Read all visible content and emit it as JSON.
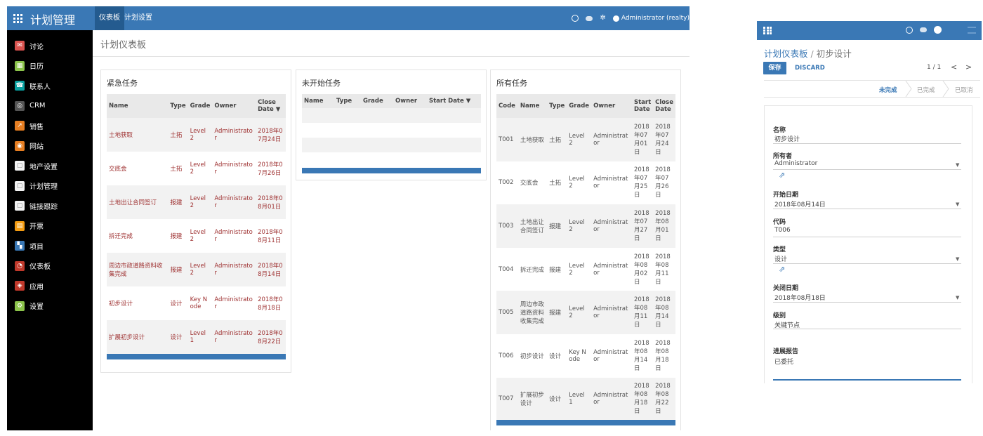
{
  "app": {
    "title": "计划管理",
    "nav": [
      "仪表板",
      "计划设置"
    ],
    "user": "Administrator (realty)"
  },
  "sidebar": {
    "items": [
      {
        "label": "讨论",
        "icon": "discuss-icon",
        "color": "#d9534f"
      },
      {
        "label": "日历",
        "icon": "calendar-icon",
        "color": "#8bc34a"
      },
      {
        "label": "联系人",
        "icon": "contacts-icon",
        "color": "#0aa0a0"
      },
      {
        "label": "CRM",
        "icon": "crm-icon",
        "color": "#555555"
      },
      {
        "label": "销售",
        "icon": "sales-icon",
        "color": "#e67e22"
      },
      {
        "label": "网站",
        "icon": "website-icon",
        "color": "#e67e22"
      },
      {
        "label": "地产设置",
        "icon": "module-icon",
        "color": "#f2f2f2"
      },
      {
        "label": "计划管理",
        "icon": "module-icon",
        "color": "#f2f2f2"
      },
      {
        "label": "链接跟踪",
        "icon": "module-icon",
        "color": "#f2f2f2"
      },
      {
        "label": "开票",
        "icon": "invoice-icon",
        "color": "#f39c12"
      },
      {
        "label": "项目",
        "icon": "project-icon",
        "color": "#3a78b5"
      },
      {
        "label": "仪表板",
        "icon": "dashboard-icon",
        "color": "#c0392b"
      },
      {
        "label": "应用",
        "icon": "apps-icon",
        "color": "#c0392b"
      },
      {
        "label": "设置",
        "icon": "settings-icon",
        "color": "#8bc34a"
      }
    ]
  },
  "page": {
    "title": "计划仪表板"
  },
  "urgent": {
    "title": "紧急任务",
    "columns": [
      "Name",
      "Type",
      "Grade",
      "Owner",
      "Close Date ▼"
    ],
    "rows": [
      [
        "土地获取",
        "土拓",
        "Level 2",
        "Administrator",
        "2018年07月24日"
      ],
      [
        "交底会",
        "土拓",
        "Level 2",
        "Administrator",
        "2018年07月26日"
      ],
      [
        "土地出让合同签订",
        "报建",
        "Level 2",
        "Administrator",
        "2018年08月01日"
      ],
      [
        "拆迁完成",
        "报建",
        "Level 2",
        "Administrator",
        "2018年08月11日"
      ],
      [
        "周边市政道路资料收集完成",
        "报建",
        "Level 2",
        "Administrator",
        "2018年08月14日"
      ],
      [
        "初步设计",
        "设计",
        "Key Node",
        "Administrator",
        "2018年08月18日"
      ],
      [
        "扩展初步设计",
        "设计",
        "Level 1",
        "Administrator",
        "2018年08月22日"
      ]
    ]
  },
  "notstarted": {
    "title": "未开始任务",
    "columns": [
      "Name",
      "Type",
      "Grade",
      "Owner",
      "Start Date ▼"
    ]
  },
  "alltasks": {
    "title": "所有任务",
    "columns": [
      "Code",
      "Name",
      "Type",
      "Grade",
      "Owner",
      "Start Date",
      "Close Date"
    ],
    "rows": [
      [
        "T001",
        "土地获取",
        "土拓",
        "Level 2",
        "Administrator",
        "2018年07月01日",
        "2018年07月24日"
      ],
      [
        "T002",
        "交底会",
        "土拓",
        "Level 2",
        "Administrator",
        "2018年07月25日",
        "2018年07月26日"
      ],
      [
        "T003",
        "土地出让合同签订",
        "报建",
        "Level 2",
        "Administrator",
        "2018年07月27日",
        "2018年08月01日"
      ],
      [
        "T004",
        "拆迁完成",
        "报建",
        "Level 2",
        "Administrator",
        "2018年08月02日",
        "2018年08月11日"
      ],
      [
        "T005",
        "周边市政道路资料收集完成",
        "报建",
        "Level 2",
        "Administrator",
        "2018年08月11日",
        "2018年08月14日"
      ],
      [
        "T006",
        "初步设计",
        "设计",
        "Key Node",
        "Administrator",
        "2018年08月14日",
        "2018年08月18日"
      ],
      [
        "T007",
        "扩展初步设计",
        "设计",
        "Level 1",
        "Administrator",
        "2018年08月18日",
        "2018年08月22日"
      ]
    ]
  },
  "form": {
    "breadcrumb_root": "计划仪表板",
    "breadcrumb_sep": "/",
    "breadcrumb_current": "初步设计",
    "save_label": "保存",
    "discard_label": "DISCARD",
    "pager": "1 / 1",
    "pager_prev": "<",
    "pager_next": ">",
    "stages": [
      "未完成",
      "已完成",
      "已取消"
    ],
    "fields": {
      "name_label": "名称",
      "name_value": "初步设计",
      "owner_label": "所有者",
      "owner_value": "Administrator",
      "start_label": "开始日期",
      "start_value": "2018年08月14日",
      "code_label": "代码",
      "code_value": "T006",
      "type_label": "类型",
      "type_value": "设计",
      "close_label": "关闭日期",
      "close_value": "2018年08月18日",
      "grade_label": "级别",
      "grade_value": "关键节点",
      "report_label": "进展报告",
      "report_value": "已委托"
    }
  },
  "colors": {
    "primary": "#3a78b5",
    "sidebar": "#000000",
    "urgent_text": "#9e3030"
  }
}
